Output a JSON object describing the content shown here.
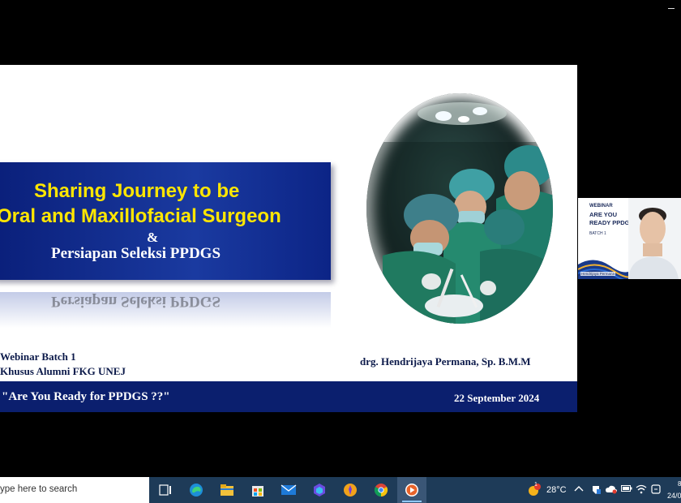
{
  "slide": {
    "title_line1": "Sharing Journey to be",
    "title_line2": "Oral and Maxillofacial Surgeon",
    "ampersand": "&",
    "subtitle": "Persiapan Seleksi PPDGS",
    "reflection_text": "Persiapan Seleksi PPDGS",
    "event_line1": "Webinar Batch 1",
    "event_line2": "Khusus Alumni FKG UNEJ",
    "presenter": "drg. Hendrijaya Permana, Sp. B.M.M",
    "tagline": "\"Are You Ready for PPDGS ??\"",
    "date": "22 September 2024",
    "photo_icon": "surgery-team-photo"
  },
  "video_tile": {
    "tag": "WEBINAR",
    "heading": "ARE YOU READY PPDGS?",
    "batch": "BATCH 1",
    "name_label": "Hendrijaya Permana"
  },
  "taskbar": {
    "search_placeholder": "ype here to search",
    "temperature": "28°C",
    "weather_badge": "1",
    "date_partial": "24/0",
    "time_partial": "8",
    "icons": [
      "task-view-icon",
      "edge-icon",
      "file-explorer-icon",
      "store-icon",
      "mail-icon",
      "app-icon",
      "app-icon-2",
      "chrome-icon",
      "media-player-icon"
    ]
  },
  "colors": {
    "slide_blue": "#0b1f6e",
    "title_yellow": "#ffe600",
    "taskbar": "#1e3b58"
  }
}
